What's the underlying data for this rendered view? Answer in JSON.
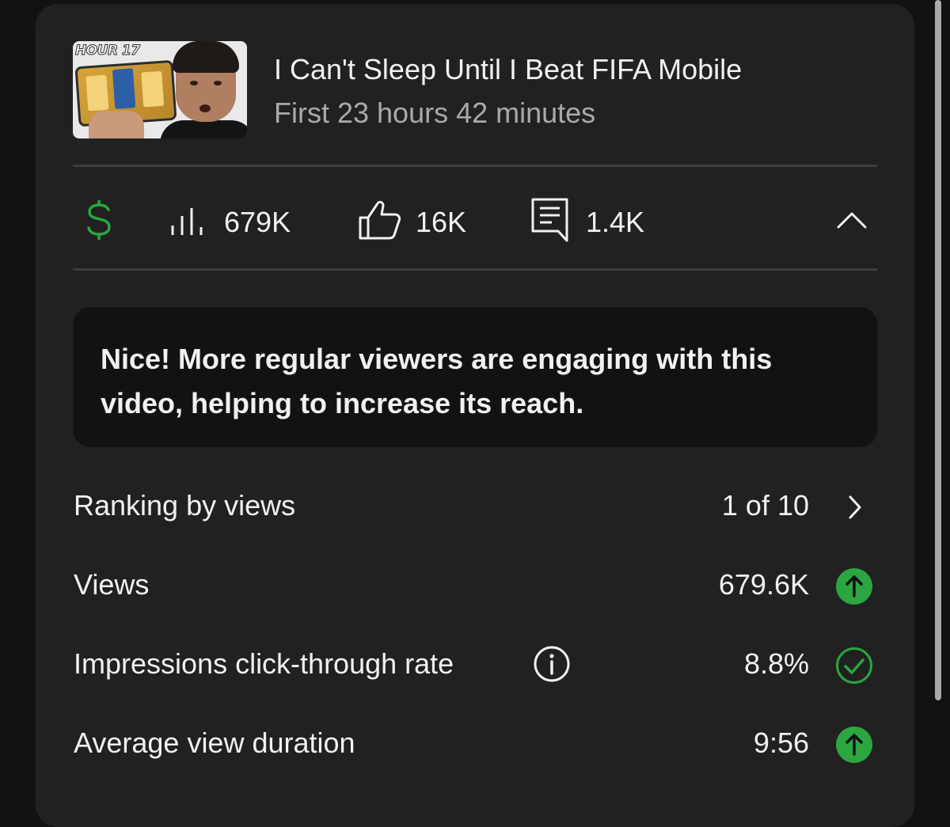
{
  "video": {
    "thumbnail_badge": "HOUR 17",
    "title": "I Can't Sleep Until I Beat FIFA Mobile",
    "period": "First 23 hours 42 minutes"
  },
  "stats": {
    "monetization_icon": "dollar-icon",
    "views": "679K",
    "likes": "16K",
    "comments": "1.4K"
  },
  "message": {
    "text": "Nice! More regular viewers are engaging with this video, helping to increase its reach."
  },
  "metrics": [
    {
      "label": "Ranking by views",
      "value": "1 of 10",
      "icon": "chevron-right-icon"
    },
    {
      "label": "Views",
      "value": "679.6K",
      "icon": "arrow-up-icon"
    },
    {
      "label": "Impressions click-through rate",
      "value": "8.8%",
      "icon": "check-circle-icon"
    },
    {
      "label": "Average view duration",
      "value": "9:56",
      "icon": "arrow-up-icon"
    }
  ],
  "colors": {
    "background": "#121212",
    "card": "#212121",
    "positive_green": "#2ba640",
    "text_primary": "#f1f1f1",
    "text_secondary": "#aaaaaa"
  }
}
